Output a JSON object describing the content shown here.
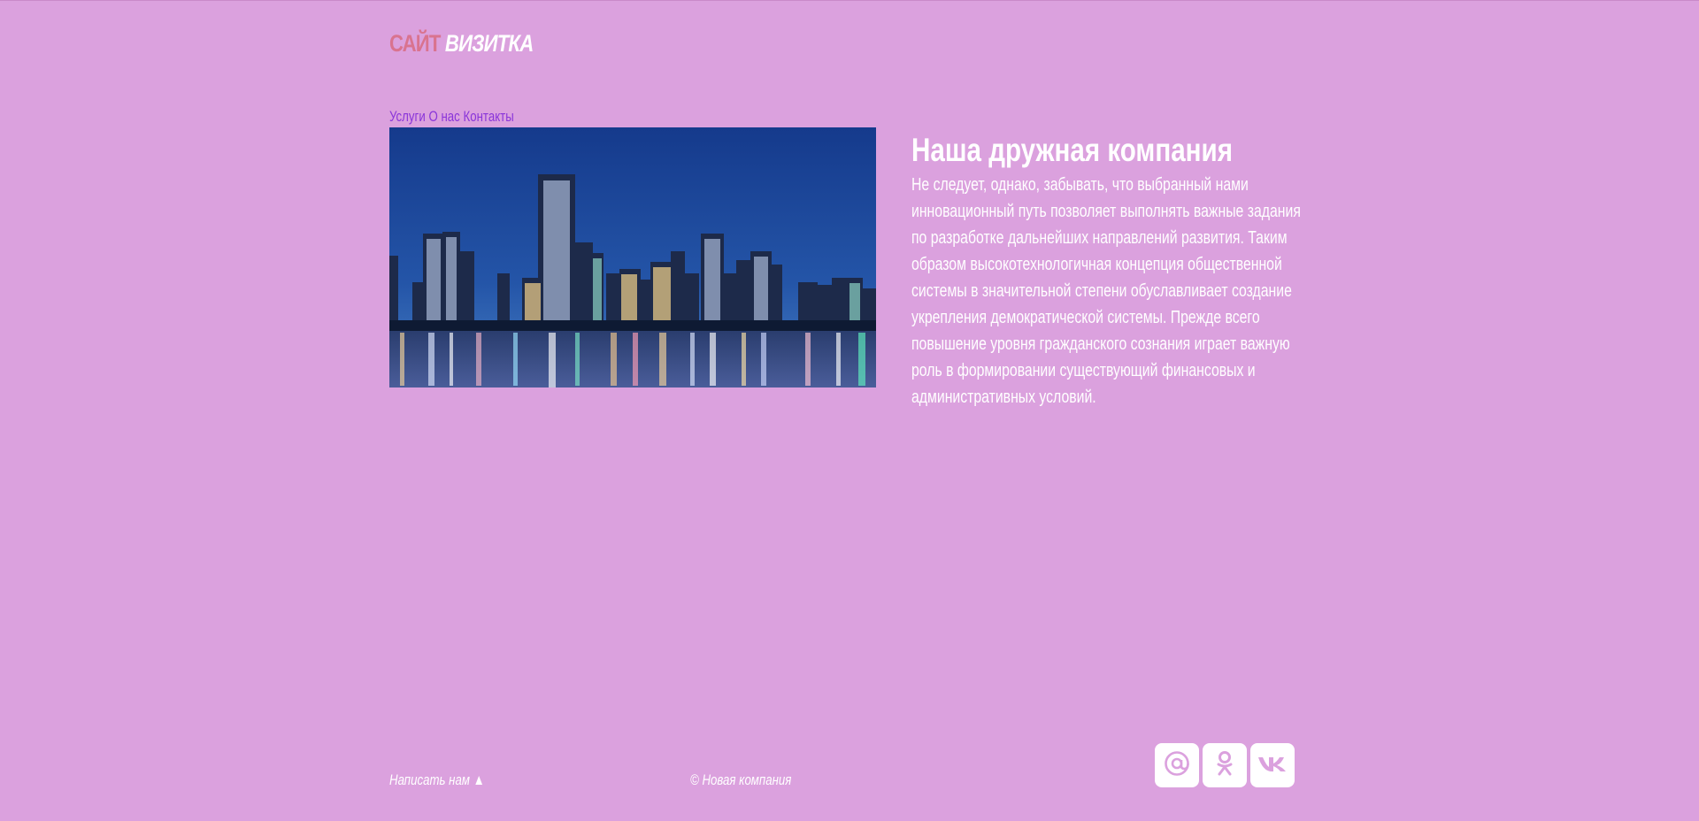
{
  "header": {
    "logo_part1": "САЙТ",
    "logo_part2": "ВИЗИТКА"
  },
  "nav": {
    "items": [
      {
        "label": "Услуги"
      },
      {
        "label": "О нас"
      },
      {
        "label": "Контакты"
      }
    ]
  },
  "main": {
    "image_icon": "city-skyline-photo",
    "title": "Наша дружная компания",
    "text": "Не следует, однако, забывать, что выбранный нами инновационный путь позволяет выполнять важные задания по разработке дальнейших направлений развития. Таким образом высокотехнологичная концепция общественной системы в значительной степени обуславливает создание укрепления демократической системы. Прежде всего повышение уровня гражданского сознания играет важную роль в формировании существующий финансовых и административных условий."
  },
  "footer": {
    "write_label": "Написать нам ▲",
    "copyright": "© Новая компания",
    "socials": [
      {
        "icon": "mail-icon"
      },
      {
        "icon": "odnoklassniki-icon"
      },
      {
        "icon": "vk-icon"
      }
    ]
  },
  "colors": {
    "background": "#dba1de",
    "logo_accent": "#d9738f",
    "nav_link": "#8a35d9",
    "text": "#ffffff"
  }
}
